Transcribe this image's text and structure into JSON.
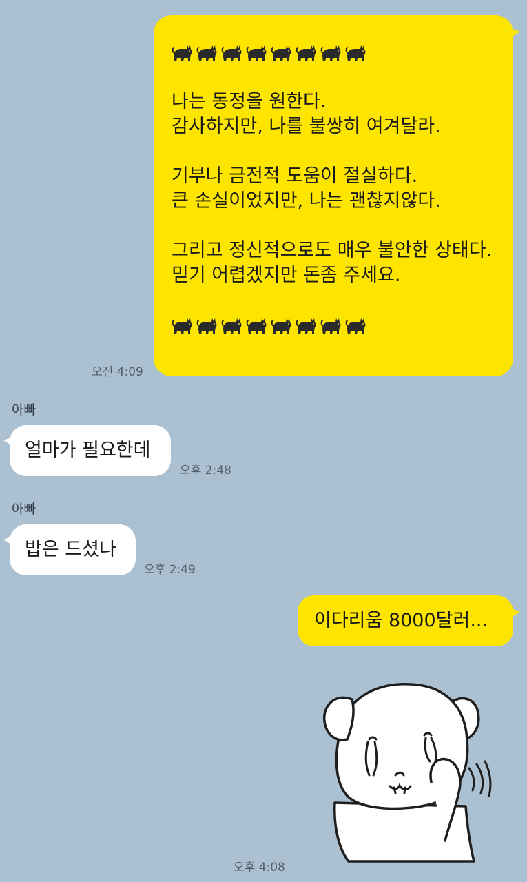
{
  "messages": {
    "first": {
      "cat_emoji": "🐈‍⬛",
      "lines": [
        "나는 동정을 원한다.",
        "감사하지만, 나를 불쌍히 여겨달라.",
        "",
        "기부나 금전적 도움이 절실하다.",
        "큰 손실이었지만, 나는 괜찮지않다.",
        "",
        "그리고 정신적으로도 매우 불안한 상태다.",
        "믿기 어렵겠지만 돈좀 주세요."
      ],
      "time": "오전 4:09"
    },
    "dad1": {
      "sender": "아빠",
      "text": "얼마가 필요한데",
      "time": "오후 2:48"
    },
    "dad2": {
      "sender": "아빠",
      "text": "밥은 드셨나",
      "time": "오후 2:49"
    },
    "reply": {
      "text": "이다리움 8000달러..."
    },
    "sticker": {
      "icon": "crying-dog-sticker",
      "time": "오후 4:08"
    }
  },
  "colors": {
    "background": "#abc1d2",
    "my_bubble": "#fde500",
    "other_bubble": "#ffffff"
  }
}
